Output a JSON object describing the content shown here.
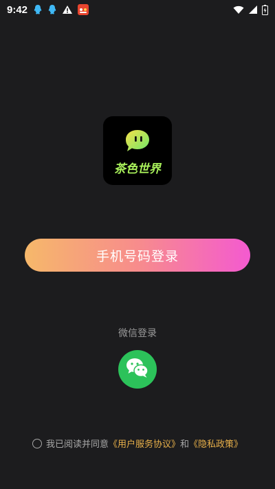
{
  "status_bar": {
    "time": "9:42",
    "icons_left": [
      "qq-icon",
      "qq-icon",
      "warning-icon",
      "app-icon"
    ],
    "icons_right": [
      "wifi-icon",
      "signal-icon",
      "battery-icon"
    ]
  },
  "logo": {
    "text": "茶色世界"
  },
  "login": {
    "phone_button_label": "手机号码登录",
    "wechat_label": "微信登录"
  },
  "agreement": {
    "prefix": "我已阅读并同意",
    "user_agreement": "《用户服务协议》",
    "and": "和",
    "privacy_policy": "《隐私政策》"
  },
  "colors": {
    "background": "#1c1c1e",
    "wechat_green": "#2cc25a",
    "link": "#e8b04a",
    "gradient_start": "#f6b86a",
    "gradient_end": "#f45ad0"
  }
}
